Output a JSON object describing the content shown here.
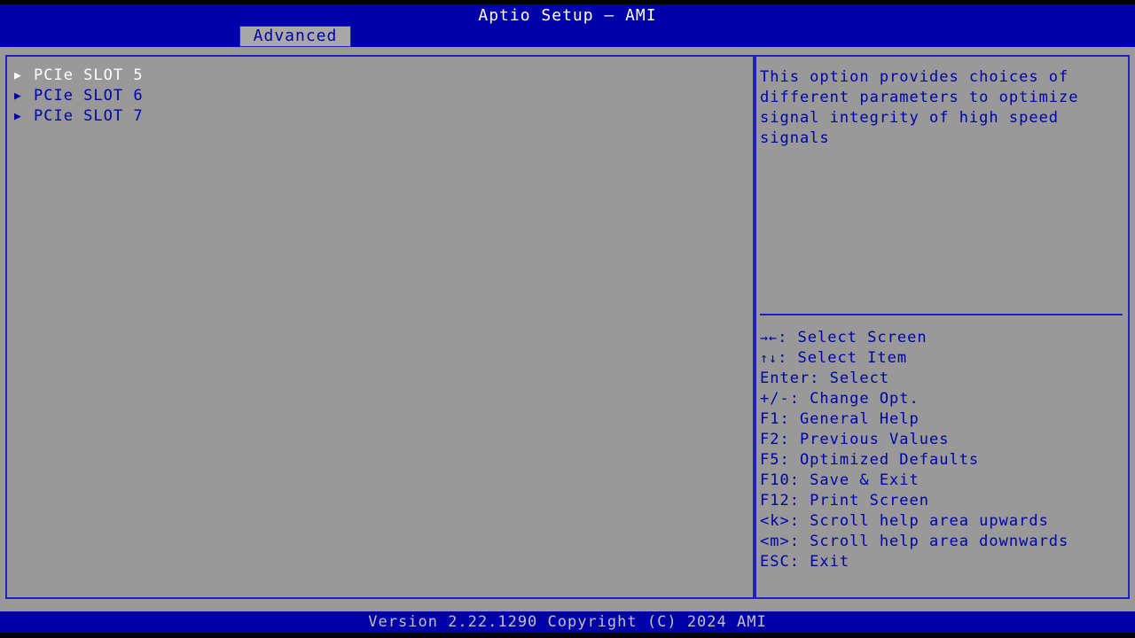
{
  "window": {
    "title": "Aptio Setup – AMI"
  },
  "tabs": [
    {
      "label": "Advanced",
      "active": true
    }
  ],
  "menu": {
    "items": [
      {
        "marker": "▶",
        "label": "PCIe SLOT 5",
        "selected": true
      },
      {
        "marker": "▶",
        "label": "PCIe SLOT 6",
        "selected": false
      },
      {
        "marker": "▶",
        "label": "PCIe SLOT 7",
        "selected": false
      }
    ]
  },
  "help": {
    "text": "This option provides choices of different parameters to optimize signal integrity of high speed signals"
  },
  "keys": [
    {
      "glyph": "→←",
      "text": ": Select Screen"
    },
    {
      "glyph": "↑↓",
      "text": ": Select Item"
    },
    {
      "glyph": "",
      "text": "Enter: Select"
    },
    {
      "glyph": "",
      "text": "+/-: Change Opt."
    },
    {
      "glyph": "",
      "text": "F1: General Help"
    },
    {
      "glyph": "",
      "text": "F2: Previous Values"
    },
    {
      "glyph": "",
      "text": "F5: Optimized Defaults"
    },
    {
      "glyph": "",
      "text": "F10: Save & Exit"
    },
    {
      "glyph": "",
      "text": "F12: Print Screen"
    },
    {
      "glyph": "",
      "text": "<k>: Scroll help area upwards"
    },
    {
      "glyph": "",
      "text": "<m>: Scroll help area downwards"
    },
    {
      "glyph": "",
      "text": "ESC: Exit"
    }
  ],
  "footer": {
    "version": "Version 2.22.1290 Copyright (C) 2024 AMI"
  },
  "colors": {
    "background": "#999999",
    "header_blue": "#0000a8",
    "text_blue": "#0000a8",
    "border_blue": "#2020c0",
    "selected_text": "#ffffff",
    "footer_text": "#c0c0c0",
    "tab_background": "#a8a8a8"
  }
}
